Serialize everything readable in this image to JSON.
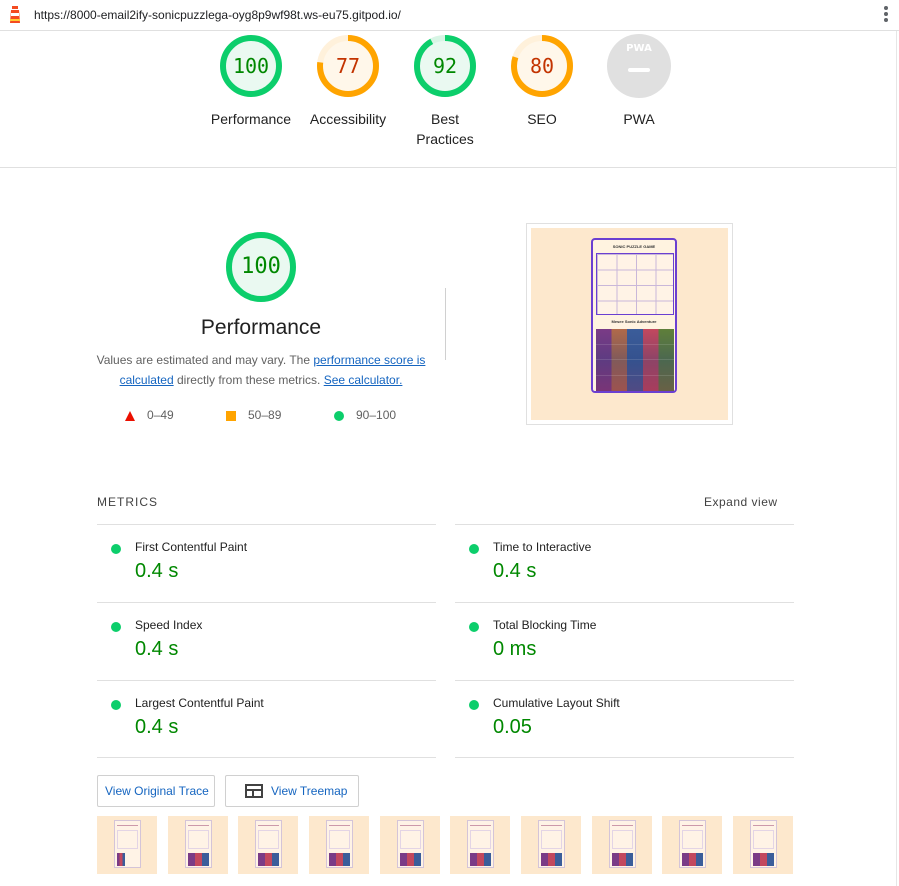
{
  "browser": {
    "url": "https://8000-email2ify-sonicpuzzlega-oyg8p9wf98t.ws-eu75.gitpod.io/"
  },
  "scores": [
    {
      "value": "100",
      "label": "Performance",
      "level": "pass",
      "fraction": 1.0
    },
    {
      "value": "77",
      "label": "Accessibility",
      "level": "average",
      "fraction": 0.77
    },
    {
      "value": "92",
      "label": "Best Practices",
      "level": "pass",
      "fraction": 0.92
    },
    {
      "value": "80",
      "label": "SEO",
      "level": "average",
      "fraction": 0.8
    },
    {
      "value": "",
      "label": "PWA",
      "level": "na",
      "badge": "PWA"
    }
  ],
  "performance": {
    "score": "100",
    "title": "Performance",
    "desc_prefix": "Values are estimated and may vary. The ",
    "desc_link1": "performance score is calculated",
    "desc_middle": " directly from these metrics. ",
    "desc_link2": "See calculator."
  },
  "legend": [
    {
      "range": "0–49",
      "shape": "triangle",
      "color": "#eb0f00"
    },
    {
      "range": "50–89",
      "shape": "square",
      "color": "#ffa400"
    },
    {
      "range": "90–100",
      "shape": "circle",
      "color": "#0cce6b"
    }
  ],
  "screenshot": {
    "app_title": "SONIC PUZZLE GAME",
    "puzzle_title": "Mesee Sonic Adventure"
  },
  "metrics": {
    "heading": "METRICS",
    "expand_label": "Expand view",
    "items": [
      {
        "title": "First Contentful Paint",
        "value": "0.4 s"
      },
      {
        "title": "Time to Interactive",
        "value": "0.4 s"
      },
      {
        "title": "Speed Index",
        "value": "0.4 s"
      },
      {
        "title": "Total Blocking Time",
        "value": "0 ms"
      },
      {
        "title": "Largest Contentful Paint",
        "value": "0.4 s"
      },
      {
        "title": "Cumulative Layout Shift",
        "value": "0.05"
      }
    ]
  },
  "buttons": {
    "trace": "View Original Trace",
    "treemap": "View Treemap"
  },
  "colors": {
    "pass": "#0cce6b",
    "average": "#ffa400",
    "fail": "#eb0f00",
    "link": "#1565c0"
  }
}
